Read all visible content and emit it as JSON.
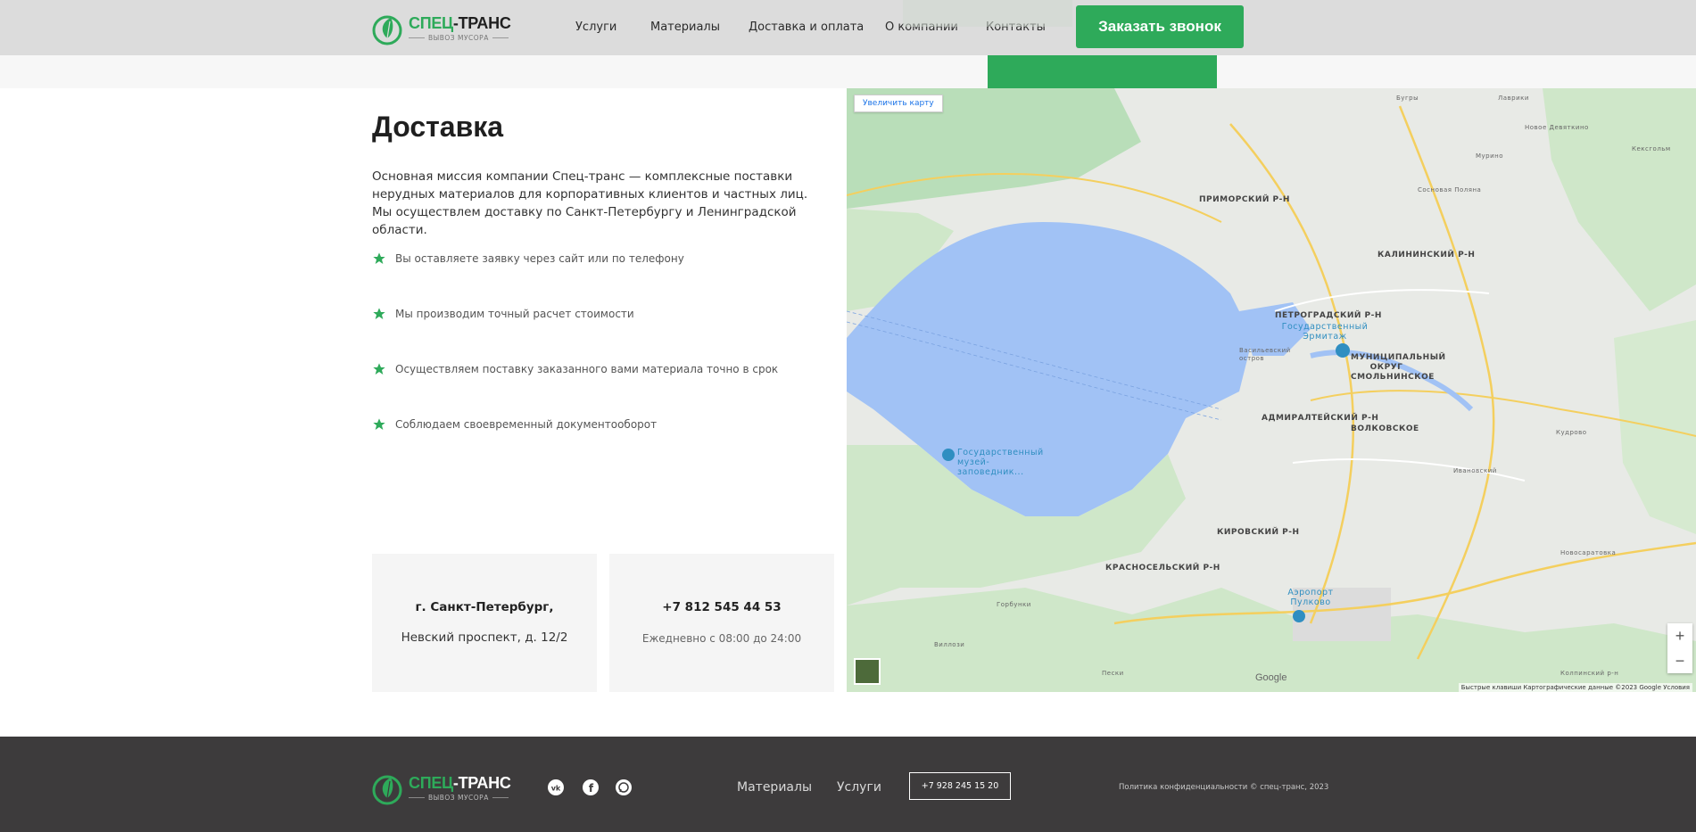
{
  "header": {
    "logo": {
      "name_green": "СПЕЦ",
      "name_dark": "-ТРАНС",
      "tagline": "ВЫВОЗ МУСОРА"
    },
    "nav": [
      "Услуги",
      "Материалы",
      "Доставка и оплата",
      "О компании",
      "Контакты"
    ],
    "cta_label": "Заказать звонок"
  },
  "main": {
    "title": "Доставка",
    "intro": "Основная миссия компании Спец-транс — комплексные поставки нерудных материалов для корпоративных клиентов и частных лиц. Мы осуществлем доставку по Санкт-Петербургу и Ленинградской области.",
    "steps": [
      "Вы оставляете заявку через сайт или по телефону",
      "Мы производим точный расчет стоимости",
      "Осуществляем поставку заказанного вами материала точно в срок",
      "Соблюдаем своевременный документооборот"
    ],
    "address_card": {
      "line1": "г. Санкт-Петербург,",
      "line2": "Невский проспект, д. 12/2"
    },
    "phone_card": {
      "phone": "+7 812 545 44 53",
      "hours": "Ежедневно с 08:00 до 24:00"
    }
  },
  "map": {
    "enlarge_label": "Увеличить карту",
    "zoom_in": "+",
    "zoom_out": "−",
    "google": "Google",
    "footer": "Быстрые клавиши   Картографические данные ©2023 Google   Условия",
    "districts": [
      "ПРИМОРСКИЙ Р-Н",
      "КАЛИНИНСКИЙ Р-Н",
      "ПЕТРОГРАДСКИЙ Р-Н",
      "МУНИЦИПАЛЬНЫЙ ОКРУГ СМОЛЬНИНСКОЕ",
      "АДМИРАЛТЕЙСКИЙ Р-Н",
      "ВОЛКОВСКОЕ",
      "КИРОВСКИЙ Р-Н",
      "КРАСНОСЕЛЬСКИЙ Р-Н"
    ],
    "pois": [
      "Государственный Эрмитаж",
      "Государственный музей-заповедник...",
      "Аэропорт Пулково"
    ],
    "places": [
      "Бугры",
      "Лаврики",
      "Новое Девяткино",
      "Мурино",
      "Кудрово",
      "Ивановский",
      "Новосаратовка",
      "Горбунки",
      "Виллози",
      "Пески",
      "Колпинский р-н",
      "Васильевский остров",
      "Сосновая Поляна",
      "Кексгольм"
    ]
  },
  "footer": {
    "logo": {
      "name_green": "СПЕЦ",
      "name_dark": "-ТРАНС",
      "tagline": "ВЫВОЗ МУСОРА"
    },
    "links": [
      "Материалы",
      "Услуги"
    ],
    "phone": "+7 928 245 15 20",
    "policy": "Политика конфиденциальности © спец-транс, 2023"
  },
  "colors": {
    "accent": "#2eaa5a",
    "header_bg": "#dcdcdc",
    "footer_bg": "#3d3b3c",
    "water": "#a1c2f5",
    "park": "#b9deb9"
  }
}
